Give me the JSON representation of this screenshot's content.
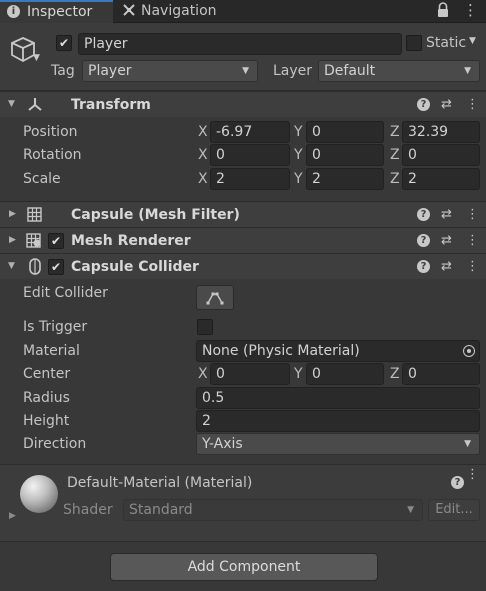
{
  "tabs": [
    {
      "label": "Inspector",
      "icon": "info-icon"
    },
    {
      "label": "Navigation",
      "icon": "navigation-icon"
    }
  ],
  "object": {
    "name": "Player",
    "active": true,
    "static_label": "Static",
    "static_checked": false,
    "tag_label": "Tag",
    "tag_value": "Player",
    "layer_label": "Layer",
    "layer_value": "Default"
  },
  "transform": {
    "title": "Transform",
    "rows": [
      {
        "label": "Position",
        "x": "-6.97",
        "y": "0",
        "z": "32.39"
      },
      {
        "label": "Rotation",
        "x": "0",
        "y": "0",
        "z": "0"
      },
      {
        "label": "Scale",
        "x": "2",
        "y": "2",
        "z": "2"
      }
    ],
    "axes": [
      "X",
      "Y",
      "Z"
    ]
  },
  "mesh_filter": {
    "title": "Capsule (Mesh Filter)"
  },
  "mesh_renderer": {
    "title": "Mesh Renderer",
    "enabled": true
  },
  "capsule_collider": {
    "title": "Capsule Collider",
    "enabled": true,
    "edit_collider_label": "Edit Collider",
    "is_trigger_label": "Is Trigger",
    "is_trigger": false,
    "material_label": "Material",
    "material_value": "None (Physic Material)",
    "center_label": "Center",
    "center": {
      "x": "0",
      "y": "0",
      "z": "0"
    },
    "radius_label": "Radius",
    "radius_value": "0.5",
    "height_label": "Height",
    "height_value": "2",
    "direction_label": "Direction",
    "direction_value": "Y-Axis"
  },
  "material": {
    "title": "Default-Material (Material)",
    "shader_label": "Shader",
    "shader_value": "Standard",
    "edit_label": "Edit..."
  },
  "add_component_label": "Add Component",
  "colors": {
    "background": "#383838",
    "field": "#2a2a2a",
    "header": "#3e3e3e",
    "tab_bar": "#282828"
  }
}
